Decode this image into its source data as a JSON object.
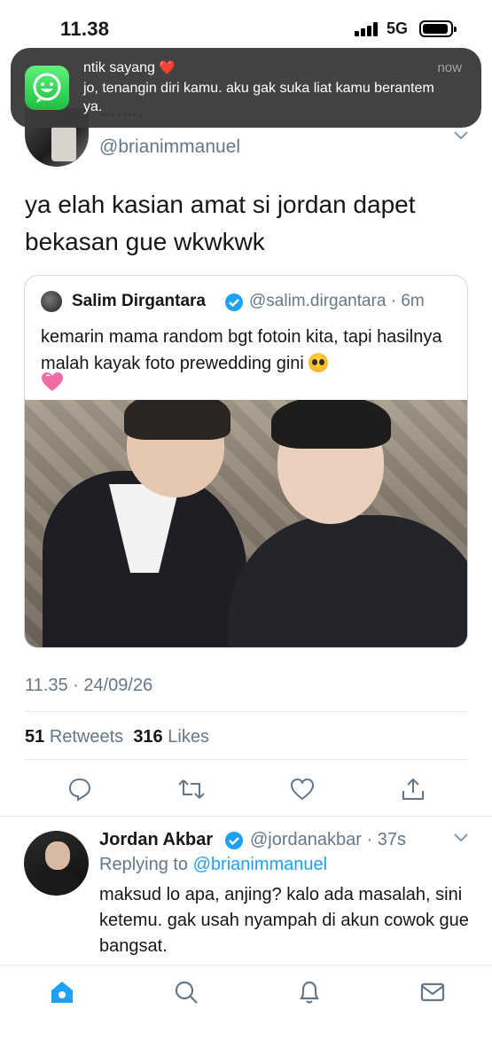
{
  "status_bar": {
    "time": "11.38",
    "network": "5G"
  },
  "notification": {
    "app_icon": "whatsapp-icon",
    "sender": "ntik sayang",
    "sender_emoji": "❤️",
    "time": "now",
    "message": "jo, tenangin diri kamu. aku gak suka liat kamu berantem ya."
  },
  "tweet": {
    "handle": "@brianimmanuel",
    "text": "ya elah kasian amat si jordan dapet bekasan gue wkwkwk",
    "timestamp": "11.35 · 24/09/26",
    "retweets_count": "51",
    "retweets_label": "Retweets",
    "likes_count": "316",
    "likes_label": "Likes"
  },
  "quoted_tweet": {
    "name": "Salim Dirgantara",
    "handle_time": "@salim.dirgantara · 6m",
    "text": "kemarin mama random bgt fotoin kita, tapi hasilnya malah kayak foto prewedding gini",
    "emojis": [
      "pleading-face",
      "pink-heart"
    ]
  },
  "reply": {
    "name": "Jordan Akbar",
    "handle_time": "@jordanakbar · 37s",
    "replying_prefix": "Replying to",
    "replying_to": "@brianimmanuel",
    "text": "maksud lo apa, anjing? kalo ada masalah, sini ketemu. gak usah nyampah di akun cowok gue bangsat."
  },
  "actions": [
    "reply-icon",
    "retweet-icon",
    "like-icon",
    "share-icon"
  ],
  "tabbar": [
    "home-icon",
    "search-icon",
    "notifications-icon",
    "messages-icon"
  ],
  "colors": {
    "accent": "#1da1f2",
    "muted": "#657786",
    "text": "#14171a",
    "notification_bg": "#3a3a3a"
  }
}
